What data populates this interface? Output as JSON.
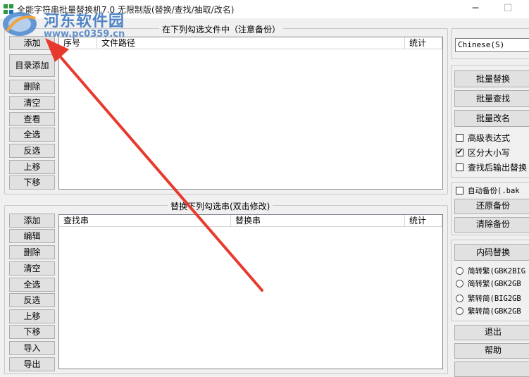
{
  "window": {
    "title": "全能字符串批量替换机7.0 无限制版(替换/查找/抽取/改名)",
    "min_glyph": "─",
    "max_glyph": "☐"
  },
  "watermark": {
    "site_name": "河东软件园",
    "url": "www.pc0359.cn"
  },
  "files_panel": {
    "title": "在下列勾选文件中（注意备份）",
    "buttons": [
      "添加",
      "目录添加",
      "删除",
      "清空",
      "查看",
      "全选",
      "反选",
      "上移",
      "下移"
    ],
    "columns": [
      "序号",
      "文件路径",
      "统计"
    ]
  },
  "replace_panel": {
    "title": "替换下列勾选串(双击修改)",
    "buttons": [
      "添加",
      "编辑",
      "删除",
      "清空",
      "全选",
      "反选",
      "上移",
      "下移",
      "导入",
      "导出"
    ],
    "columns": [
      "查找串",
      "替换串",
      "统计"
    ]
  },
  "right_panel": {
    "language": "Chinese(S)",
    "actions": [
      "批量替换",
      "批量查找",
      "批量改名"
    ],
    "options": [
      {
        "label": "高级表达式",
        "checked": false
      },
      {
        "label": "区分大小写",
        "checked": true
      },
      {
        "label": "查找后输出替换",
        "checked": false
      }
    ],
    "backup": {
      "auto_label": "自动备份(.bak",
      "auto_checked": false,
      "restore": "还原备份",
      "clear": "清除备份"
    },
    "encoding": {
      "button": "内码替换",
      "options": [
        "简转繁(GBK2BIG",
        "简转繁(GBK2GB",
        "繁转简(BIG2GB",
        "繁转简(GBK2GB"
      ]
    },
    "exit": "退出",
    "help": "帮助"
  },
  "colors": {
    "annotation_arrow": "#e8392e",
    "watermark": "#3f79c2",
    "icon_green": "#2e9a3e"
  },
  "icons": [
    "app-icon",
    "minimize-icon",
    "maximize-icon",
    "watermark-logo-icon",
    "annotation-arrow-icon"
  ]
}
